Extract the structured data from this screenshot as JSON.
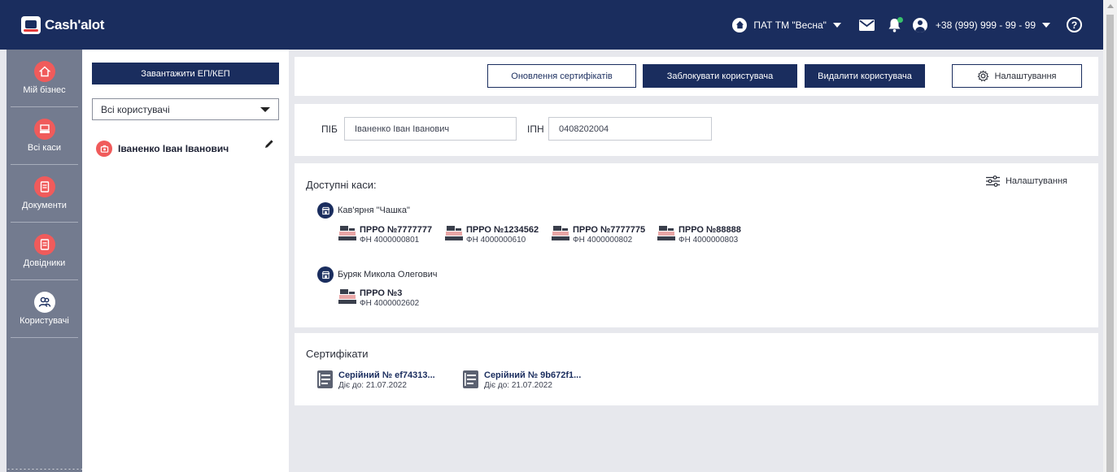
{
  "app": {
    "logo_text": "Cash'alot"
  },
  "header": {
    "company": "ПАТ ТМ \"Весна\"",
    "phone": "+38 (999) 999 - 99 - 99",
    "help_glyph": "?"
  },
  "nav": {
    "items": [
      {
        "label": "Мій бізнес",
        "icon": "home-icon"
      },
      {
        "label": "Всі каси",
        "icon": "cash-register-icon"
      },
      {
        "label": "Документи",
        "icon": "document-icon"
      },
      {
        "label": "Довідники",
        "icon": "reference-icon"
      },
      {
        "label": "Користувачі",
        "icon": "users-icon"
      }
    ]
  },
  "users_panel": {
    "upload_label": "Завантажити ЕП/КЕП",
    "filter_value": "Всі користувачі",
    "users": [
      {
        "name": "Іваненко Іван Іванович"
      }
    ]
  },
  "actions": {
    "update_certs": "Оновлення сертифікатів",
    "block_user": "Заблокувати користувача",
    "delete_user": "Видалити користувача",
    "settings": "Налаштування"
  },
  "fields": {
    "pib_label": "ПІБ",
    "pib_value": "Іваненко Іван Іванович",
    "ipn_label": "ІПН",
    "ipn_value": "0408202004"
  },
  "kasy": {
    "title": "Доступні каси:",
    "settings_label": "Налаштування",
    "groups": [
      {
        "name": "Кав'ярня \"Чашка\"",
        "prro": [
          {
            "name": "ПРРО №7777777",
            "fn": "ФН 4000000801"
          },
          {
            "name": "ПРРО №1234562",
            "fn": "ФН 4000000610"
          },
          {
            "name": "ПРРО №7777775",
            "fn": "ФН 4000000802"
          },
          {
            "name": "ПРРО №88888",
            "fn": "ФН 4000000803"
          }
        ]
      },
      {
        "name": "Буряк Микола Олегович",
        "prro": [
          {
            "name": "ПРРО №3",
            "fn": "ФН 4000002602"
          }
        ]
      }
    ]
  },
  "certificates": {
    "title": "Сертифікати",
    "items": [
      {
        "serial": "Серійний № ef74313...",
        "valid": "Діє до: 21.07.2022"
      },
      {
        "serial": "Серійний № 9b672f1...",
        "valid": "Діє до: 21.07.2022"
      }
    ]
  },
  "colors": {
    "navy": "#1a2d5e",
    "accent_red": "#f05b5b",
    "nav_gray": "#737b8f",
    "online_green": "#37c06b"
  }
}
